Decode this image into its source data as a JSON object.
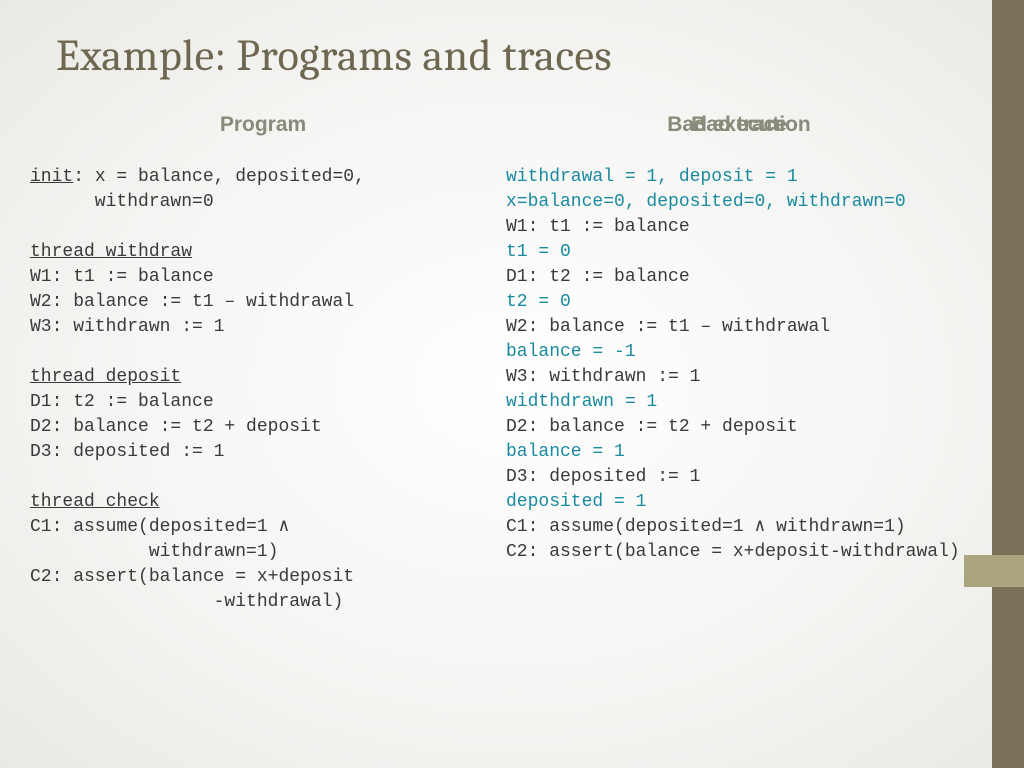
{
  "title": "Example: Programs and traces",
  "left": {
    "header": "Program",
    "init_label": "init",
    "init_rest": ": x = balance, deposited=0,\n      withdrawn=0",
    "tw_label": "thread_withdraw",
    "tw_body": "W1: t1 := balance\nW2: balance := t1 – withdrawal\nW3: withdrawn := 1",
    "td_label": "thread_deposit",
    "td_body": "D1: t2 := balance\nD2: balance := t2 + deposit\nD3: deposited := 1",
    "tc_label": "thread_check",
    "tc_body": "C1: assume(deposited=1 ∧\n           withdrawn=1)\nC2: assert(balance = x+deposit\n                 -withdrawal)"
  },
  "right": {
    "header_a": "Bad trace",
    "header_b": "Bad execution",
    "l1": "withdrawal = 1, deposit = 1",
    "l2": "x=balance=0, deposited=0, withdrawn=0",
    "l3": "W1: t1 := balance",
    "l4": "t1 = 0",
    "l5": "D1: t2 := balance",
    "l6": "t2 = 0",
    "l7": "W2: balance := t1 – withdrawal",
    "l8": "balance = -1",
    "l9": "W3: withdrawn := 1",
    "l10": "widthdrawn = 1",
    "l11": "D2: balance := t2 + deposit",
    "l12": "balance = 1",
    "l13": "D3: deposited := 1",
    "l14": "deposited = 1",
    "l15": "C1: assume(deposited=1 ∧ withdrawn=1)",
    "l16": "C2: assert(balance = x+deposit-withdrawal)"
  }
}
